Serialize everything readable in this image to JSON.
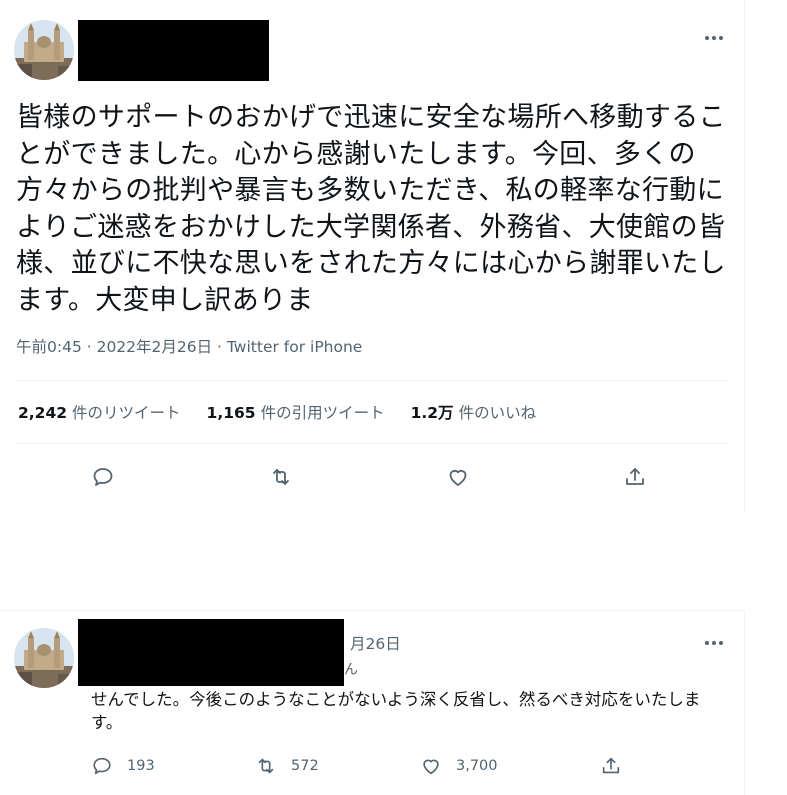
{
  "main_tweet": {
    "text": "皆様のサポートのおかげで迅速に安全な場所へ移動することができました。心から感謝いたします。今回、多くの方々からの批判や暴言も多数いただき、私の軽率な行動によりご迷惑をおかけした大学関係者、外務省、大使館の皆様、並びに不快な思いをされた方々には心から謝罪いたします。大変申し訳ありま",
    "timestamp": "午前0:45 · 2022年2月26日 · ",
    "client": "Twitter for iPhone",
    "stats": [
      {
        "value": "2,242",
        "label": "件のリツイート"
      },
      {
        "value": "1,165",
        "label": "件の引用ツイート"
      },
      {
        "value": "1.2万",
        "label": "件のいいね"
      }
    ],
    "actions": [
      "reply-icon",
      "retweet-icon",
      "like-icon",
      "share-icon"
    ]
  },
  "reply_tweet": {
    "date": "月26日",
    "partial_text": "ん",
    "text": "せんでした。今後このようなことがないよう深く反省し、然るべき対応をいたします。",
    "counts": {
      "replies": "193",
      "retweets": "572",
      "likes": "3,700"
    }
  },
  "colors": {
    "text_primary": "#0f1419",
    "text_secondary": "#536471",
    "divider": "#eff3f4"
  }
}
